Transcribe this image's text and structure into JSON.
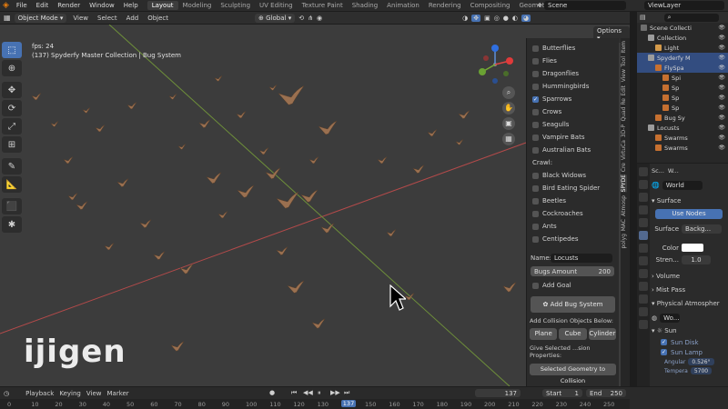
{
  "topbar": {
    "menu": [
      "File",
      "Edit",
      "Render",
      "Window",
      "Help"
    ],
    "workspaces": [
      "Layout",
      "Modeling",
      "Sculpting",
      "UV Editing",
      "Texture Paint",
      "Shading",
      "Animation",
      "Rendering",
      "Compositing",
      "Geometry Nodes"
    ],
    "active_workspace": "Layout",
    "scene": "Scene",
    "view_layer": "ViewLayer"
  },
  "viewport_header": {
    "mode": "Object Mode",
    "menus": [
      "View",
      "Select",
      "Add",
      "Object"
    ],
    "transform": "Global",
    "options": "Options"
  },
  "viewport": {
    "info_line1": "fps: 24",
    "info_line2": "(137) Spyderfy Master Collection | Bug System",
    "watermark": "ijigen"
  },
  "npanel": {
    "flyers": [
      {
        "label": "Butterflies",
        "checked": false
      },
      {
        "label": "Flies",
        "checked": false
      },
      {
        "label": "Dragonflies",
        "checked": false
      },
      {
        "label": "Hummingbirds",
        "checked": false
      },
      {
        "label": "Sparrows",
        "checked": true
      },
      {
        "label": "Crows",
        "checked": false
      },
      {
        "label": "Seagulls",
        "checked": false
      },
      {
        "label": "Vampire Bats",
        "checked": false
      },
      {
        "label": "Australian Bats",
        "checked": false
      }
    ],
    "crawl_label": "Crawl:",
    "crawlers": [
      {
        "label": "Black Widows",
        "checked": false
      },
      {
        "label": "Bird Eating Spider",
        "checked": false
      },
      {
        "label": "Beetles",
        "checked": false
      },
      {
        "label": "Cockroaches",
        "checked": false
      },
      {
        "label": "Ants",
        "checked": false
      },
      {
        "label": "Centipedes",
        "checked": false
      }
    ],
    "name_label": "Name:",
    "name_value": "Locusts",
    "bugs_amount_label": "Bugs Amount",
    "bugs_amount_value": "200",
    "add_goal": "Add Goal",
    "add_bug_system": "Add Bug System",
    "add_collision_label": "Add Collision Objects Below:",
    "collision_buttons": [
      "Plane",
      "Cube",
      "Cylinder"
    ],
    "give_selected": "Give Selected ...sion Properties:",
    "selected_geometry": "Selected Geometry to Collision"
  },
  "vtabs": [
    "Item",
    "Tool",
    "View",
    "Edit",
    "Quad Re",
    "3D-P",
    "VirtuCa",
    "Cre",
    "SPYDE",
    "Atmosp",
    "MAC",
    "polyg"
  ],
  "outliner": {
    "rows": [
      {
        "label": "Scene Collecti",
        "indent": 0
      },
      {
        "label": "Collection",
        "indent": 1
      },
      {
        "label": "Light",
        "indent": 2
      },
      {
        "label": "Spyderfy M",
        "indent": 1
      },
      {
        "label": "FlySpa",
        "indent": 2
      },
      {
        "label": "Spi",
        "indent": 3
      },
      {
        "label": "Sp",
        "indent": 3
      },
      {
        "label": "Sp",
        "indent": 3
      },
      {
        "label": "Sp",
        "indent": 3
      },
      {
        "label": "Bug Sy",
        "indent": 2
      },
      {
        "label": "Locusts",
        "indent": 1
      },
      {
        "label": "Swarms",
        "indent": 2
      },
      {
        "label": "Swarms",
        "indent": 2
      }
    ]
  },
  "properties": {
    "scene_label": "Sc...",
    "world_label": "W...",
    "world_name": "World",
    "surface_header": "Surface",
    "use_nodes": "Use Nodes",
    "surface_label": "Surface",
    "surface_value": "Backg...",
    "color_label": "Color",
    "strength_label": "Stren...",
    "strength_value": "1.0",
    "volume_header": "Volume",
    "mist_header": "Mist Pass",
    "physical_header": "Physical Atmospher",
    "wo_field": "Wo...",
    "sun_header": "Sun",
    "sun_disk": "Sun Disk",
    "sun_lamp": "Sun Lamp",
    "angle_label": "Angular",
    "angle_value": "0.526°",
    "temp_label": "Tempera",
    "temp_value": "5700"
  },
  "timeline": {
    "menus": [
      "Playback",
      "Keying",
      "View",
      "Marker"
    ],
    "current_frame": "137",
    "start_label": "Start",
    "start_value": "1",
    "end_label": "End",
    "end_value": "250",
    "ticks": [
      "0",
      "10",
      "20",
      "30",
      "40",
      "50",
      "60",
      "70",
      "80",
      "90",
      "100",
      "110",
      "120",
      "130",
      "137",
      "150",
      "160",
      "170",
      "180",
      "190",
      "200",
      "210",
      "220",
      "230",
      "240",
      "250"
    ]
  },
  "colors": {
    "accent": "#4772b3",
    "bird": "#9a7050",
    "viewport": "#3c3c3c"
  }
}
